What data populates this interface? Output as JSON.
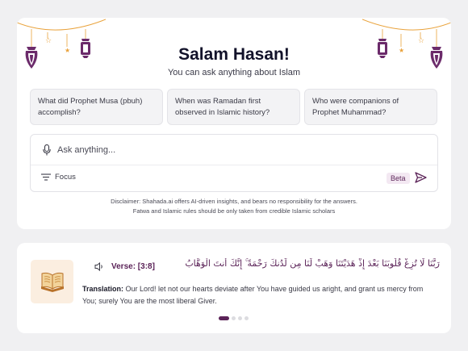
{
  "header": {
    "greeting": "Salam Hasan!",
    "subtitle": "You can ask anything about Islam"
  },
  "suggestions": [
    {
      "line1": "What did Prophet Musa (pbuh)",
      "line2": "accomplish?"
    },
    {
      "line1": "When was Ramadan first",
      "line2": "observed in Islamic history?"
    },
    {
      "line1": "Who were companions of",
      "line2": "Prophet Muhammad?"
    }
  ],
  "chat": {
    "placeholder": "Ask anything...",
    "focus_label": "Focus",
    "beta_label": "Beta"
  },
  "disclaimer": {
    "line1": "Disclaimer: Shahada.ai offers AI-driven insights, and bears no responsibility for the answers.",
    "line2": "Fatwa and Islamic rules should be only taken from credible Islamic scholars"
  },
  "verse": {
    "label": "Verse: [3:8]",
    "arabic": "رَبَّنَا لَا تُزِغْ قُلُوبَنَا بَعْدَ إِذْ هَدَيْتَنَا وَهَبْ لَنَا مِن لَّدُنكَ رَحْمَةً ۚ إِنَّكَ أَنتَ الْوَهَّابُ",
    "translation_label": "Translation:",
    "translation_text": " Our Lord! let not our hearts deviate after You have guided us aright, and grant us mercy from You; surely You are the most liberal Giver."
  },
  "carousel": {
    "count": 4,
    "active_index": 0
  },
  "icons": {
    "mic": "microphone-icon",
    "focus": "filter-lines-icon",
    "send": "send-arrow-icon",
    "speaker": "speaker-icon",
    "quran": "open-quran-book-icon",
    "lantern": "hanging-lantern-icon",
    "star": "hanging-star-icon"
  },
  "colors": {
    "accent": "#5b2358",
    "gold": "#e9a23b",
    "lantern": "#6b2a6a",
    "card_bg": "#ffffff",
    "page_bg": "#f0f0f2"
  }
}
